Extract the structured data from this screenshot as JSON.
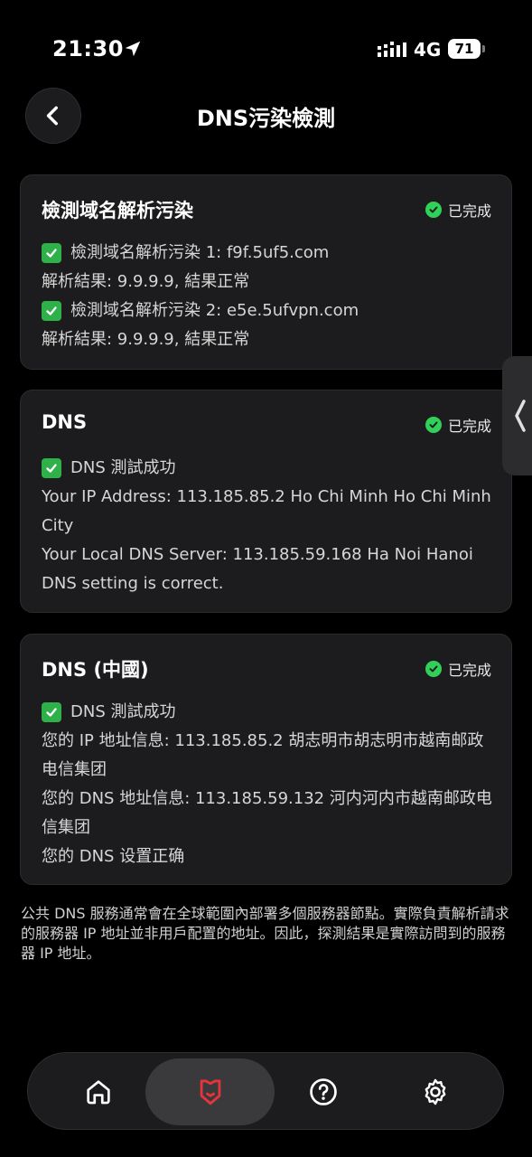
{
  "status_bar": {
    "time": "21:30",
    "network": "4G",
    "battery": "71"
  },
  "header": {
    "title": "DNS污染檢測"
  },
  "cards": [
    {
      "title": "檢測域名解析污染",
      "status": "已完成",
      "lines": [
        {
          "check": true,
          "text": "檢測域名解析污染 1: f9f.5uf5.com"
        },
        {
          "check": false,
          "text": "解析結果: 9.9.9.9, 結果正常"
        },
        {
          "check": true,
          "text": "檢測域名解析污染 2: e5e.5ufvpn.com"
        },
        {
          "check": false,
          "text": "解析結果: 9.9.9.9, 結果正常"
        }
      ]
    },
    {
      "title": "DNS",
      "status": "已完成",
      "lines": [
        {
          "check": true,
          "text": "DNS 測試成功"
        },
        {
          "check": false,
          "text": "Your IP Address: 113.185.85.2 Ho Chi Minh Ho Chi Minh City"
        },
        {
          "check": false,
          "text": "Your Local DNS Server: 113.185.59.168 Ha Noi Hanoi"
        },
        {
          "check": false,
          "text": "DNS setting is correct."
        }
      ]
    },
    {
      "title": "DNS (中國)",
      "status": "已完成",
      "lines": [
        {
          "check": true,
          "text": "DNS 測試成功"
        },
        {
          "check": false,
          "text": "您的 IP 地址信息: 113.185.85.2 胡志明市胡志明市越南邮政电信集团"
        },
        {
          "check": false,
          "text": "您的 DNS 地址信息: 113.185.59.132 河内河内市越南邮政电信集团"
        },
        {
          "check": false,
          "text": "您的 DNS 设置正确"
        }
      ]
    }
  ],
  "footnote": "公共 DNS 服務通常會在全球範圍內部署多個服務器節點。實際負責解析請求的服務器 IP 地址並非用戶配置的地址。因此，探測結果是實際訪問到的服務器 IP 地址。",
  "tabbar": {
    "items": [
      {
        "icon": "home-icon",
        "active": false
      },
      {
        "icon": "shield-icon",
        "active": true
      },
      {
        "icon": "help-icon",
        "active": false
      },
      {
        "icon": "gear-icon",
        "active": false
      }
    ],
    "accent": "#e5343c"
  },
  "colors": {
    "success": "#30d158",
    "card_bg": "#1c1c1e",
    "background": "#000000"
  }
}
